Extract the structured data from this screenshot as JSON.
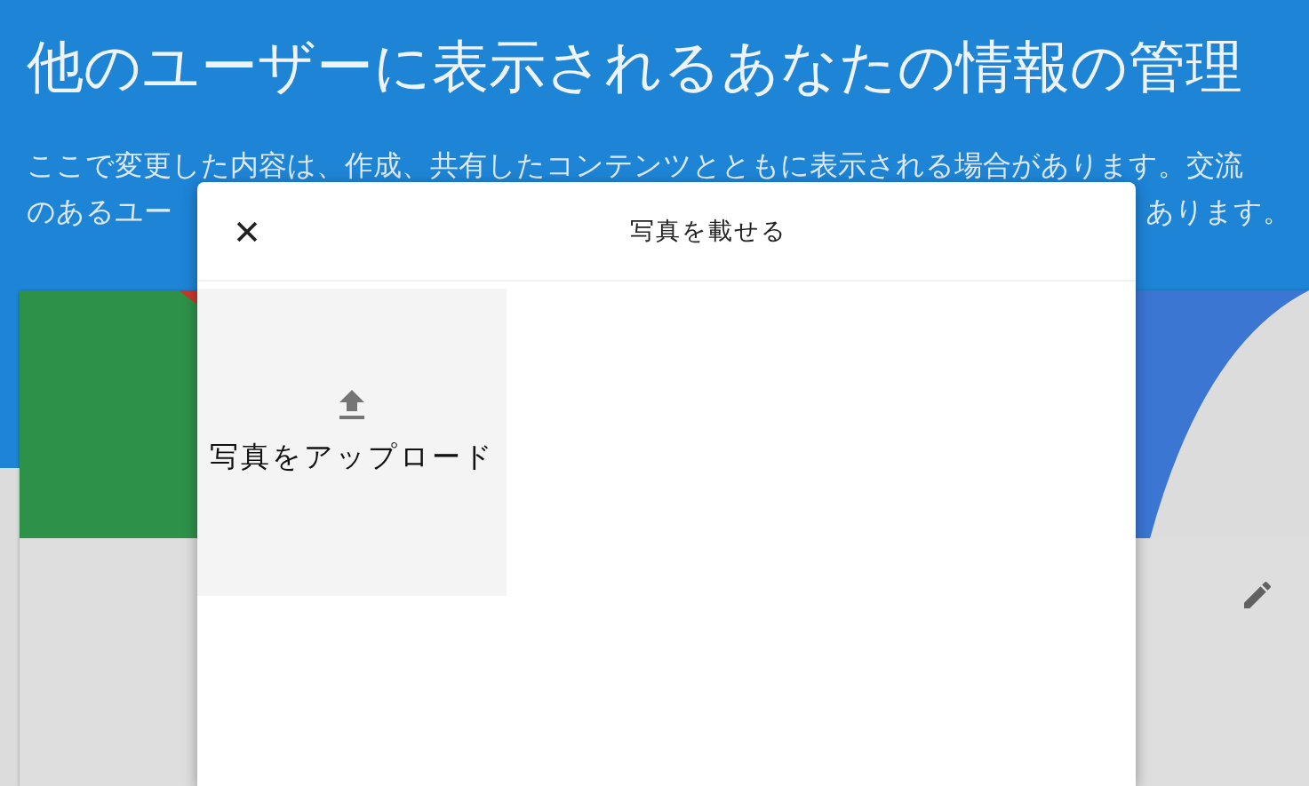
{
  "page": {
    "title": "他のユーザーに表示されるあなたの情報の管理",
    "description_line_1": "ここで変更した内容は、作成、共有したコンテンツとともに表示される場合があります。交流",
    "description_line_2_left": "のあるユー",
    "description_line_2_right": "あります。"
  },
  "dialog": {
    "title": "写真を載せる",
    "tiles": [
      {
        "kind": "upload",
        "label": "写真をアップロード"
      }
    ]
  }
}
